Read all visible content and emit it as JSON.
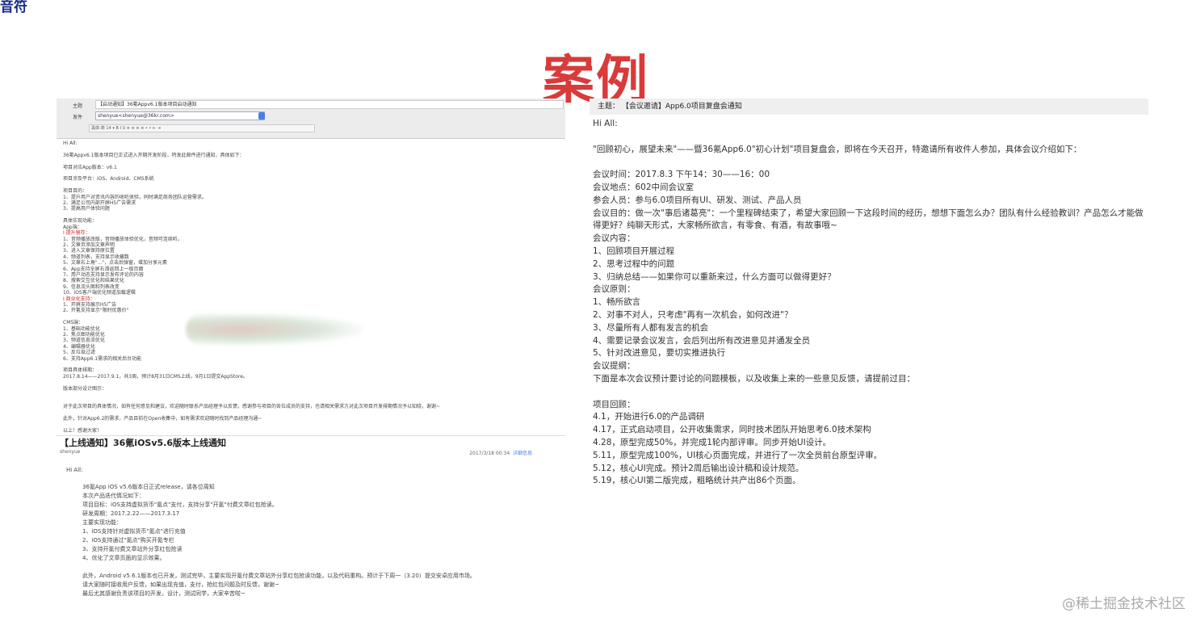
{
  "corner_text": "音符",
  "title": "案例",
  "watermark": "@稀土掘金技术社区",
  "left": {
    "compose": {
      "subject_label": "主题",
      "subject_value": "【启动通知】36氪Appv6.1版本项目启动通知",
      "from_label": "发件",
      "from_value": "shenyue<shenyue@36kr.com>",
      "toolbar_text": "黑体-简   14   ▾   B   I   U   ≡   ≡   ≡   ≡   •   •   ⇤   ⇥"
    },
    "email1_lines": [
      {
        "text": "Hi All:",
        "red": false
      },
      {
        "text": "",
        "red": false
      },
      {
        "text": "     36氪Appv6.1版本项目已正式进入开期开发阶段，特发此邮件进行通知，具体如下：",
        "red": false
      },
      {
        "text": "",
        "red": false
      },
      {
        "text": "     项目对应App版本：v6.1",
        "red": false
      },
      {
        "text": "",
        "red": false
      },
      {
        "text": "     项目涉及平台：iOS、Android、CMS系统",
        "red": false
      },
      {
        "text": "",
        "red": false
      },
      {
        "text": "     项目目的：",
        "red": false
      },
      {
        "text": "     1、提升用户对资讯内容的收听体验，同时满足商务团队运营需求。",
        "red": false
      },
      {
        "text": "     2、满足公司内部开屏H5广告需求",
        "red": false
      },
      {
        "text": "     3、提高用户体验问题",
        "red": false
      },
      {
        "text": "",
        "red": false
      },
      {
        "text": "     具体实现功能：",
        "red": false
      },
      {
        "text": "     App端：",
        "red": false
      },
      {
        "text": "     I 提升留存：",
        "red": true
      },
      {
        "text": "     1、音频播放改版，音频播放体验优化，音频可连续听。",
        "red": false
      },
      {
        "text": "     2、文章页添加文章声明",
        "red": false
      },
      {
        "text": "     3、进入文章保持原位置",
        "red": false
      },
      {
        "text": "     4、频道列表，支持显示收藏数",
        "red": false
      },
      {
        "text": "     5、文章右上角\"...\"，点击后弹窗，增加分享元素",
        "red": false
      },
      {
        "text": "     6、App支持全屏右滑返回上一级页面",
        "red": false
      },
      {
        "text": "     7、用户动态支持显示发布评论的内容",
        "red": false
      },
      {
        "text": "     8、搜索交互优化和结果优化",
        "red": false
      },
      {
        "text": "     9、信息流头图和列表改变",
        "red": false
      },
      {
        "text": "     10、iOS客户端优化频道加载逻辑",
        "red": false
      },
      {
        "text": "     I 商业化支持：",
        "red": true
      },
      {
        "text": "     1、开屏支持展示H5广告",
        "red": false
      },
      {
        "text": "     2、开氪支持显示\"限时优惠价\"",
        "red": false
      },
      {
        "text": "",
        "red": false
      },
      {
        "text": "     CMS端：",
        "red": false
      },
      {
        "text": "     1、基础功能优化",
        "red": false
      },
      {
        "text": "     2、焦点图功能优化",
        "red": false
      },
      {
        "text": "     3、频道信息流优化",
        "red": false
      },
      {
        "text": "     4、编辑器优化",
        "red": false
      },
      {
        "text": "     5、反垃圾过滤",
        "red": false
      },
      {
        "text": "     6、支持App6.1需求的相关后台功能",
        "red": false
      },
      {
        "text": "",
        "red": false
      },
      {
        "text": "     项目具体排期：",
        "red": false
      },
      {
        "text": "     2017.8.14——2017.9.1，共3周，预计8月31日CMS上线，9月1日提交AppStore。",
        "red": false
      },
      {
        "text": "",
        "red": false
      },
      {
        "text": "     版本部分设计图示：",
        "red": false
      },
      {
        "text": "",
        "red": false
      },
      {
        "text": "",
        "red": false
      },
      {
        "text": "     对于此次项目的具体情况，如有任何意见和建议，欢迎随时联系产品经理予以反馈，感谢参与项目的各位成员的支持，也请相关需求方对此次项目开发排期情况予以知晓，谢谢~",
        "red": false
      },
      {
        "text": "",
        "red": false
      },
      {
        "text": "     此外，针对App6.2的需求，产品目前在Open收集中，如有需求欢迎随时找到产品经理沟通~",
        "red": false
      },
      {
        "text": "",
        "red": false
      },
      {
        "text": "     以上！感谢大家！",
        "red": false
      }
    ],
    "email2": {
      "heading": "【上线通知】36氪iOSv5.6版本上线通知",
      "sender": "shenyue",
      "date": "2017/3/18  00:34",
      "details_link": "详细信息",
      "greeting": "Hi All:",
      "lines": [
        "36氪App iOS v5.6版本日正式release，请各位周知",
        "本次产品迭代情况如下：",
        "项目目标：iOS支持虚拟货币\"氪点\"支付，支持分享\"开氪\"付费文章红包抢读。",
        "研发周期：2017.2.22——2017.3.17",
        "主要实现功能：",
        "1、iOS支持针对虚拟货币\"氪点\"进行充值",
        "2、iOS支持通过\"氪点\"购买开氪专栏",
        "3、支持开氪付费文章站外分享红包抢读",
        "4、优化了文章页面的显示效果。",
        "",
        "此外，Android v5.6.1版本也已开发，测试完毕，主要实现开氪付费文章站外分享红包抢读功能，以及代码重构。预计于下周一（3.20）提交安卓应用市场。",
        "请大家随时接收用户反馈，如果出现充值，支付，抢红包问题及时反馈，谢谢~",
        "最后尤其感谢负责该项目的开发，设计，测试同学，大家辛苦啦~"
      ]
    }
  },
  "right": {
    "subject_label": "主题：",
    "subject_value": "【会议邀请】App6.0项目复盘会通知",
    "lines": [
      "Hi All:",
      "",
      "\"回顾初心，展望未来\"——暨36氪App6.0\"初心计划\"项目复盘会，即将在今天召开，特邀请所有收件人参加，具体会议介绍如下：",
      "",
      "会议时间：2017.8.3 下午14：30——16：00",
      "会议地点：602中间会议室",
      "参会人员：参与6.0项目所有UI、研发、测试、产品人员",
      "会议目的：做一次\"事后诸葛亮\"：一个里程碑结束了，希望大家回顾一下这段时间的经历，想想下面怎么办？团队有什么经验教训？产品怎么才能做",
      "得更好？纯聊天形式，大家畅所欲言，有零食、有酒，有故事哦~",
      "会议内容：",
      "1、回顾项目开展过程",
      "2、思考过程中的问题",
      "3、归纳总结——如果你可以重新来过，什么方面可以做得更好？",
      "会议原则：",
      "1、畅所欲言",
      "2、对事不对人，只考虑\"再有一次机会，如何改进\"？",
      "3、尽量所有人都有发言的机会",
      "4、需要记录会议发言，会后列出所有改进意见并通发全员",
      "5、针对改进意见，要切实推进执行",
      "会议提纲：",
      "下面是本次会议预计要讨论的问题模板，以及收集上来的一些意见反馈，请提前过目：",
      "",
      "项目回顾：",
      "4.1，开始进行6.0的产品调研",
      "4.17，正式启动项目，公开收集需求，同时技术团队开始思考6.0技术架构",
      "4.28，原型完成50%，并完成1轮内部评审。同步开始UI设计。",
      "5.11，原型完成100%，UI核心页面完成，并进行了一次全员前台原型评审。",
      "5.12，核心UI完成。预计2周后输出设计稿和设计规范。",
      "5.19，核心UI第二版完成，粗略统计共产出86个页面。"
    ]
  }
}
